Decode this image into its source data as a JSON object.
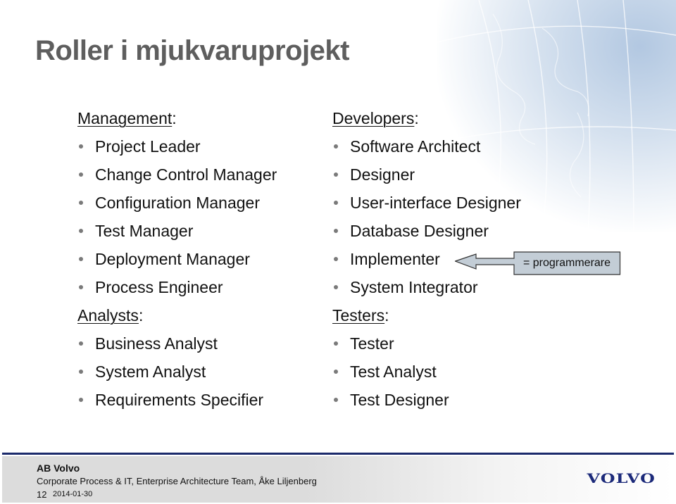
{
  "slide": {
    "title": "Roller i mjukvaruprojekt"
  },
  "left_column": {
    "groups": [
      {
        "heading": "Management",
        "items": [
          "Project Leader",
          "Change Control Manager",
          "Configuration Manager",
          "Test Manager",
          "Deployment Manager",
          "Process Engineer"
        ]
      },
      {
        "heading": "Analysts",
        "items": [
          "Business Analyst",
          "System Analyst",
          "Requirements Specifier"
        ]
      }
    ]
  },
  "right_column": {
    "groups": [
      {
        "heading": "Developers",
        "items": [
          "Software Architect",
          "Designer",
          "User-interface Designer",
          "Database Designer",
          "Implementer",
          "System Integrator"
        ]
      },
      {
        "heading": "Testers",
        "items": [
          "Tester",
          "Test Analyst",
          "Test Designer"
        ]
      }
    ]
  },
  "heading_suffix": ":",
  "callout": {
    "label": "= programmerare",
    "points_to": "Implementer",
    "fill_color": "#c3cdd6",
    "border_color": "#333333"
  },
  "footer": {
    "company": "AB Volvo",
    "department": "Corporate Process & IT, Enterprise Architecture Team, Åke Liljenberg",
    "page_number": "12",
    "date": "2014-01-30",
    "logo_text": "VOLVO",
    "divider_color": "#1b2a6b",
    "logo_color": "#1c2a7a"
  }
}
